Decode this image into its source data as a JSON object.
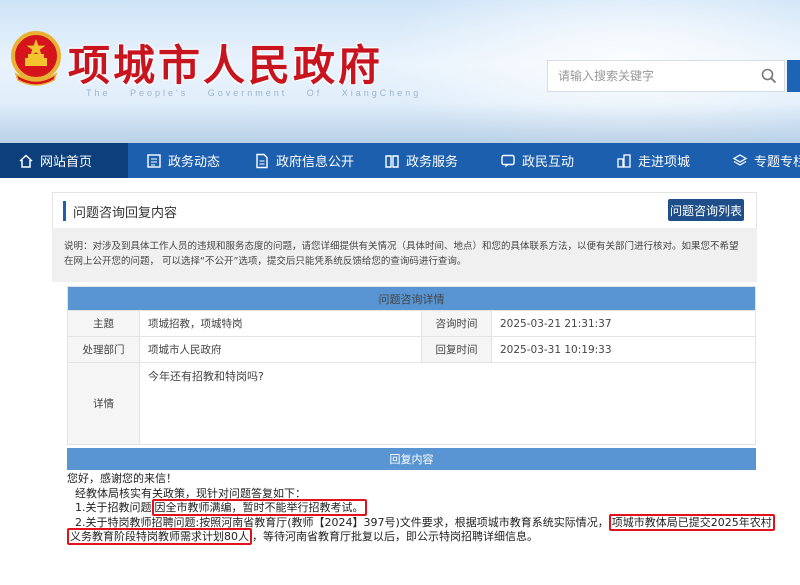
{
  "header": {
    "title": "项城市人民政府",
    "subtitle": "The People's Government Of XiangCheng",
    "search_placeholder": "请输入搜索关键字"
  },
  "nav": {
    "items": [
      {
        "label": "网站首页",
        "icon": "home-icon"
      },
      {
        "label": "政务动态",
        "icon": "news-icon"
      },
      {
        "label": "政府信息公开",
        "icon": "document-icon"
      },
      {
        "label": "政务服务",
        "icon": "service-icon"
      },
      {
        "label": "政民互动",
        "icon": "chat-icon"
      },
      {
        "label": "走进项城",
        "icon": "city-icon"
      },
      {
        "label": "专题专栏",
        "icon": "layers-icon"
      }
    ]
  },
  "panel": {
    "title": "问题咨询回复内容",
    "list_button": "问题咨询列表",
    "notice": "说明：对涉及到具体工作人员的违规和服务态度的问题，请您详细提供有关情况（具体时间、地点）和您的具体联系方法，以便有关部门进行核对。如果您不希望在网上公开您的问题， 可以选择“不公开”选项，提交后只能凭系统反馈给您的查询码进行查询。"
  },
  "detail": {
    "section_title": "问题咨询详情",
    "subject_label": "主题",
    "subject": "项城招教，项城特岗",
    "ask_time_label": "咨询时间",
    "ask_time": "2025-03-21 21:31:37",
    "dept_label": "处理部门",
    "dept": "项城市人民政府",
    "reply_time_label": "回复时间",
    "reply_time": "2025-03-31 10:19:33",
    "content_label": "详情",
    "content": "今年还有招教和特岗吗?"
  },
  "reply": {
    "section_title": "回复内容",
    "line1": "您好，感谢您的来信！",
    "line2": "经教体局核实有关政策，现针对问题答复如下：",
    "line3_prefix": "1.关于招教问题",
    "line3_mark": "因全市教师满编，暂时不能举行招教考试。",
    "line4_prefix": "2.关于特岗教师招聘问题:按照河南省教育厅(教师【2024】397号)文件要求，根据项城市教育系统实际情况，",
    "line4_mark": "项城市教体局已提交2025年农村",
    "line5_mark": "义务教育阶段特岗教师需求计划80人",
    "line5_suffix": "，等待河南省教育厅批复以后，即公示特岗招聘详细信息。"
  },
  "colors": {
    "nav_bg": "#1c5fae",
    "nav_active": "#0d3f7d",
    "section_header": "#5a95d3",
    "title_red": "#c8141e",
    "highlight_box": "#e1121b"
  }
}
